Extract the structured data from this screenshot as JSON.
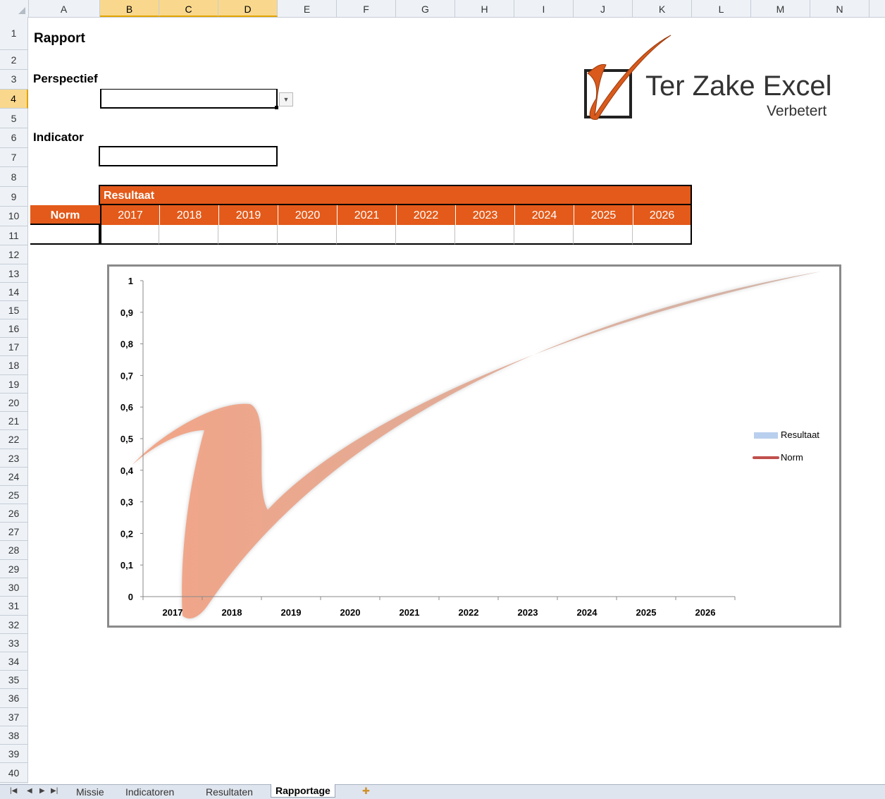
{
  "columns": [
    "A",
    "B",
    "C",
    "D",
    "E",
    "F",
    "G",
    "H",
    "I",
    "J",
    "K",
    "L",
    "M",
    "N"
  ],
  "rows": [
    "1",
    "2",
    "3",
    "4",
    "5",
    "6",
    "7",
    "8",
    "9",
    "10",
    "11",
    "12",
    "13",
    "14",
    "15",
    "16",
    "17",
    "18",
    "19",
    "20",
    "21",
    "22",
    "23",
    "24",
    "25",
    "26",
    "27",
    "28",
    "29",
    "30",
    "31",
    "32",
    "33",
    "34",
    "35",
    "36",
    "37",
    "38",
    "39",
    "40"
  ],
  "selected_cell": "B4",
  "sheet": {
    "title": "Rapport",
    "perspectief_label": "Perspectief",
    "perspectief_value": "",
    "indicator_label": "Indicator",
    "indicator_value": ""
  },
  "table": {
    "resultaat_header": "Resultaat",
    "norm_header": "Norm",
    "years": [
      "2017",
      "2018",
      "2019",
      "2020",
      "2021",
      "2022",
      "2023",
      "2024",
      "2025",
      "2026"
    ]
  },
  "logo": {
    "title": "Ter Zake Excel",
    "subtitle": "Verbetert"
  },
  "chart_data": {
    "type": "line",
    "categories": [
      "2017",
      "2018",
      "2019",
      "2020",
      "2021",
      "2022",
      "2023",
      "2024",
      "2025",
      "2026"
    ],
    "y_ticks": [
      "0",
      "0,1",
      "0,2",
      "0,3",
      "0,4",
      "0,5",
      "0,6",
      "0,7",
      "0,8",
      "0,9",
      "1"
    ],
    "ylim": [
      0,
      1
    ],
    "series": [
      {
        "name": "Resultaat",
        "values": [],
        "color": "#b9cfee"
      },
      {
        "name": "Norm",
        "values": [],
        "color": "#c0504d"
      }
    ],
    "legend": "right",
    "grid": false
  },
  "tabs": {
    "items": [
      "Missie",
      "Indicatoren",
      "Resultaten",
      "Rapportage"
    ],
    "active": "Rapportage"
  },
  "colors": {
    "accent": "#e35a1a",
    "selection": "#f9d88d"
  }
}
